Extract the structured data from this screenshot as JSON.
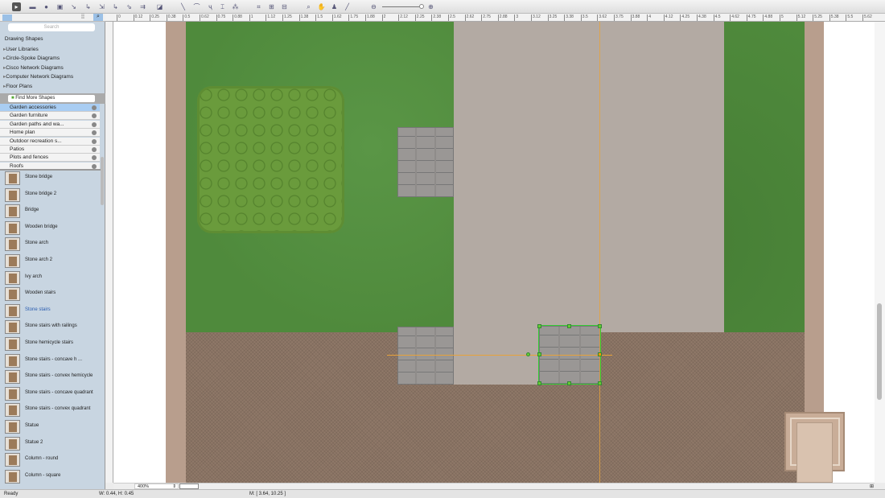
{
  "sidebar": {
    "search_placeholder": "Search",
    "tree": [
      "Drawing Shapes",
      "User Libraries",
      "Circle-Spoke Diagrams",
      "Cisco Network Diagrams",
      "Computer Network Diagrams",
      "Floor Plans"
    ],
    "find_more": "Find More Shapes",
    "libraries": [
      "Garden accessories",
      "Garden furniture",
      "Garden paths and wa...",
      "Home plan",
      "Outdoor recreation s...",
      "Patios",
      "Plots and fences",
      "Roofs"
    ],
    "shapes": [
      "Stone bridge",
      "Stone bridge 2",
      "Bridge",
      "Wooden bridge",
      "Stone arch",
      "Stone arch 2",
      "Ivy arch",
      "Wooden stairs",
      "Stone stairs",
      "Stone stairs with railings",
      "Stone hemicycle stairs",
      "Stone stairs - concave h ...",
      "Stone stairs - convex hemicycle",
      "Stone stairs - concave quadrant",
      "Stone stairs - convex quadrant",
      "Statue",
      "Statue 2",
      "Column - round",
      "Column - square"
    ],
    "selected_shape": "Stone stairs"
  },
  "ruler": {
    "ticks": [
      "0",
      "0.12",
      "0.25",
      "0.38",
      "0.5",
      "0.62",
      "0.75",
      "0.88",
      "1",
      "1.12",
      "1.25",
      "1.38",
      "1.5",
      "1.62",
      "1.75",
      "1.88",
      "2",
      "2.12",
      "2.25",
      "2.38",
      "2.5",
      "2.62",
      "2.75",
      "2.88",
      "3",
      "3.12",
      "3.25",
      "3.38",
      "3.5",
      "3.62",
      "3.75",
      "3.88",
      "4",
      "4.12",
      "4.25",
      "4.38",
      "4.5",
      "4.62",
      "4.75",
      "4.88",
      "5",
      "5.12",
      "5.25",
      "5.38",
      "5.5",
      "5.62"
    ]
  },
  "zoom": {
    "level": "400%",
    "slider_fraction": 0.92
  },
  "status": {
    "ready": "Ready",
    "size": "W: 0.44,  H: 0.45",
    "mouse": "M: [ 3.64, 10.25 ]"
  },
  "colors": {
    "grass": "#4f8a3c",
    "path": "#b3aaa3",
    "ground": "#8f7868",
    "accent": "#2a5db0"
  }
}
